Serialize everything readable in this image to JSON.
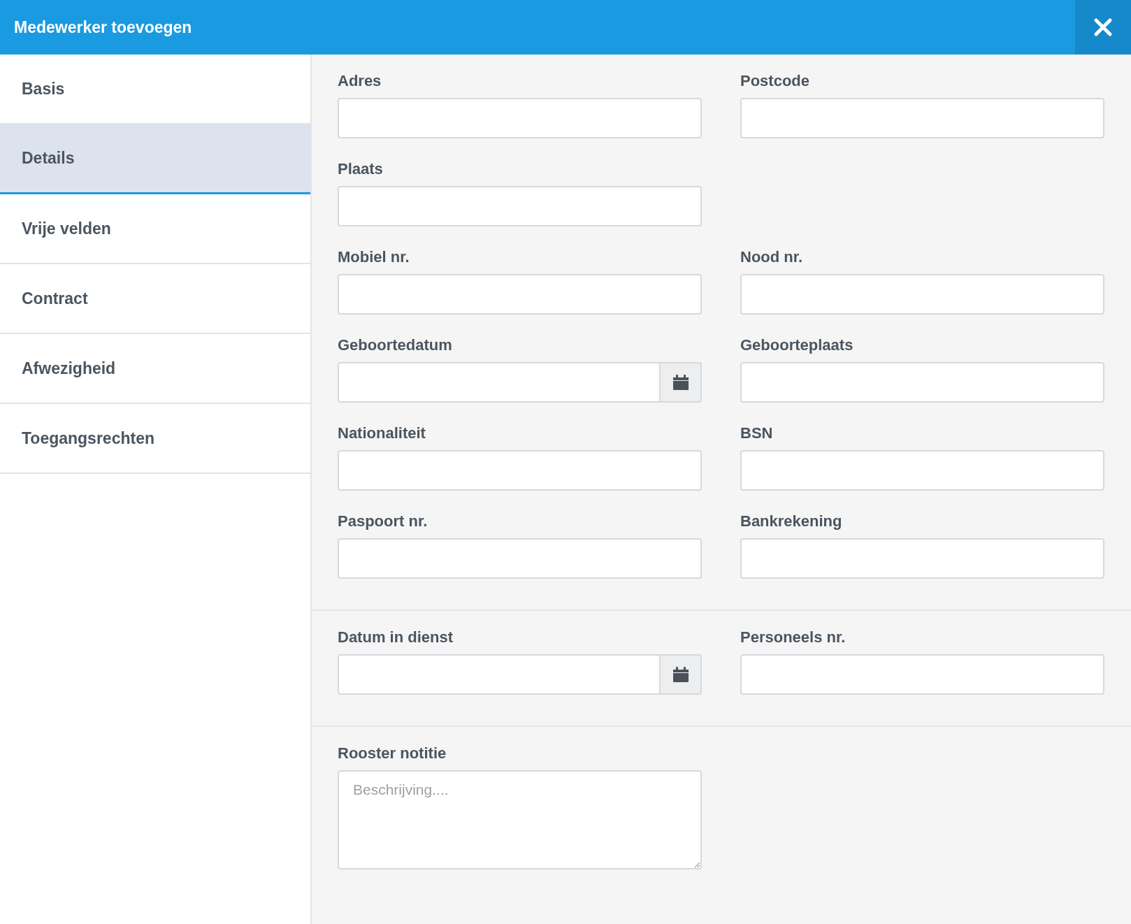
{
  "header": {
    "title": "Medewerker toevoegen"
  },
  "sidebar": {
    "items": [
      {
        "label": "Basis",
        "selected": false
      },
      {
        "label": "Details",
        "selected": true
      },
      {
        "label": "Vrije velden",
        "selected": false
      },
      {
        "label": "Contract",
        "selected": false
      },
      {
        "label": "Afwezigheid",
        "selected": false
      },
      {
        "label": "Toegangsrechten",
        "selected": false
      }
    ]
  },
  "sections": [
    {
      "rows": [
        [
          {
            "label": "Adres",
            "kind": "text"
          },
          {
            "label": "Postcode",
            "kind": "text"
          }
        ],
        [
          {
            "label": "Plaats",
            "kind": "text"
          }
        ],
        [
          {
            "label": "Mobiel nr.",
            "kind": "text"
          },
          {
            "label": "Nood nr.",
            "kind": "text"
          }
        ],
        [
          {
            "label": "Geboortedatum",
            "kind": "date"
          },
          {
            "label": "Geboorteplaats",
            "kind": "text"
          }
        ],
        [
          {
            "label": "Nationaliteit",
            "kind": "text"
          },
          {
            "label": "BSN",
            "kind": "text"
          }
        ],
        [
          {
            "label": "Paspoort nr.",
            "kind": "text"
          },
          {
            "label": "Bankrekening",
            "kind": "text"
          }
        ]
      ]
    },
    {
      "rows": [
        [
          {
            "label": "Datum in dienst",
            "kind": "date"
          },
          {
            "label": "Personeels nr.",
            "kind": "text"
          }
        ]
      ]
    },
    {
      "rows": [
        [
          {
            "label": "Rooster notitie",
            "kind": "textarea",
            "placeholder": "Beschrijving...."
          }
        ]
      ]
    }
  ]
}
